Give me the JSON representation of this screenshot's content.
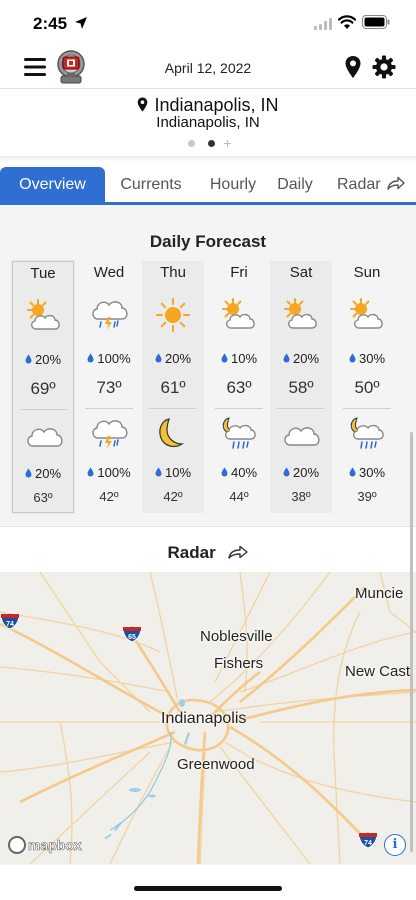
{
  "status_bar": {
    "time": "2:45"
  },
  "header": {
    "date": "April 12, 2022"
  },
  "location": {
    "primary": "Indianapolis, IN",
    "secondary": "Indianapolis, IN",
    "plus": "+"
  },
  "tabs": [
    {
      "label": "Overview"
    },
    {
      "label": "Currents"
    },
    {
      "label": "Hourly"
    },
    {
      "label": "Daily"
    },
    {
      "label": "Radar"
    }
  ],
  "daily_forecast": {
    "title": "Daily Forecast",
    "days": [
      {
        "day": "Tue",
        "day_icon": "partly-sunny-icon",
        "day_precip": "20%",
        "high": "69º",
        "night_icon": "cloudy-icon",
        "night_precip": "20%",
        "low": "63º"
      },
      {
        "day": "Wed",
        "day_icon": "thunderstorm-icon",
        "day_precip": "100%",
        "high": "73º",
        "night_icon": "thunderstorm-icon",
        "night_precip": "100%",
        "low": "42º"
      },
      {
        "day": "Thu",
        "day_icon": "sunny-icon",
        "day_precip": "20%",
        "high": "61º",
        "night_icon": "crescent-moon-icon",
        "night_precip": "10%",
        "low": "42º"
      },
      {
        "day": "Fri",
        "day_icon": "partly-sunny-icon",
        "day_precip": "10%",
        "high": "63º",
        "night_icon": "night-rain-icon",
        "night_precip": "40%",
        "low": "44º"
      },
      {
        "day": "Sat",
        "day_icon": "partly-sunny-icon",
        "day_precip": "20%",
        "high": "58º",
        "night_icon": "cloudy-icon",
        "night_precip": "20%",
        "low": "38º"
      },
      {
        "day": "Sun",
        "day_icon": "partly-sunny-icon",
        "day_precip": "30%",
        "high": "50º",
        "night_icon": "night-rain-icon",
        "night_precip": "30%",
        "low": "39º"
      }
    ]
  },
  "radar": {
    "title": "Radar",
    "cities": [
      "Muncie",
      "Noblesville",
      "Fishers",
      "New Castl",
      "Indianapolis",
      "Greenwood"
    ],
    "shields": [
      "74",
      "65",
      "74"
    ],
    "attribution": "mapbox",
    "info_label": "i"
  },
  "colors": {
    "accent": "#2f6fd1",
    "sun": "#f5a623",
    "rain_drop": "#2a6fd0",
    "moon": "#f2c230",
    "road": "#f4c98a"
  }
}
